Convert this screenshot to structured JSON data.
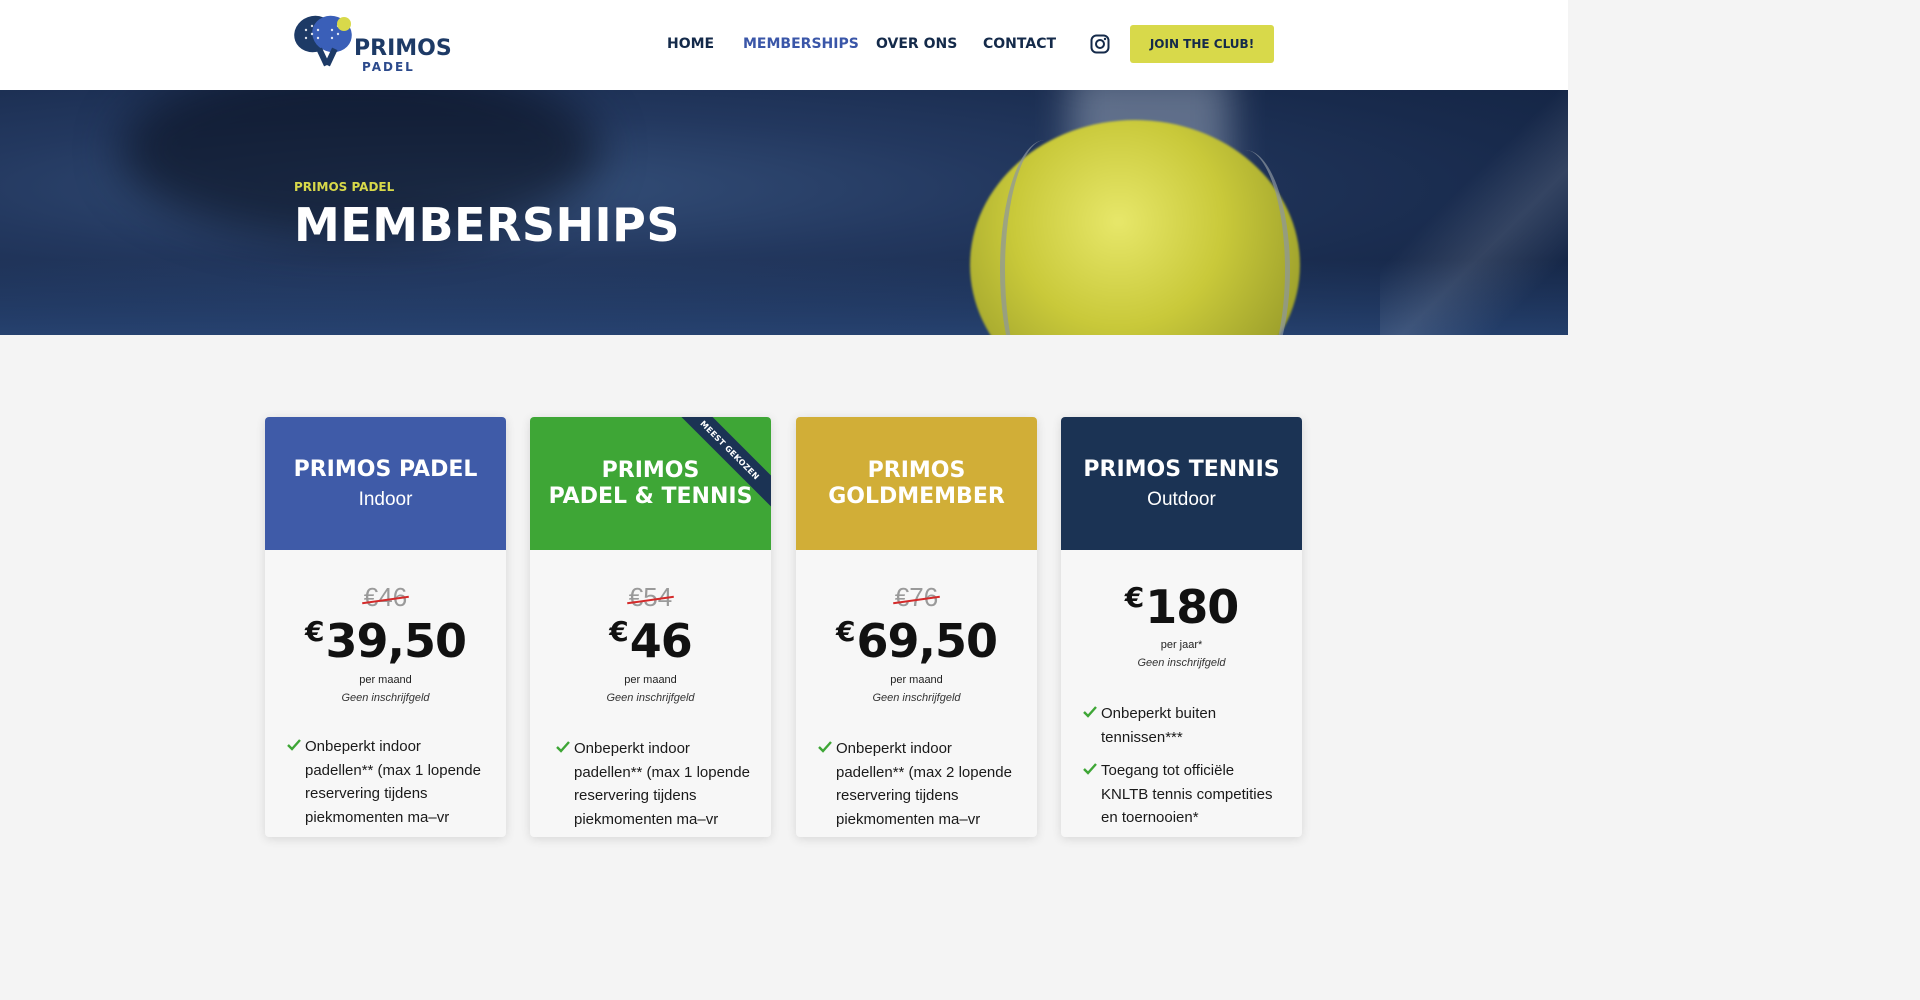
{
  "header": {
    "logo": {
      "word": "PRIMOS",
      "sub": "PADEL"
    },
    "nav": [
      {
        "label": "HOME",
        "active": false
      },
      {
        "label": "MEMBERSHIPS",
        "active": true
      },
      {
        "label": "OVER ONS",
        "active": false
      },
      {
        "label": "CONTACT",
        "active": false
      }
    ],
    "social_icon": "instagram-icon",
    "cta_label": "JOIN THE CLUB!"
  },
  "hero": {
    "subtitle": "PRIMOS PADEL",
    "title": "MEMBERSHIPS"
  },
  "colors": {
    "padel": "#3f5ba8",
    "padel_tennis": "#3ea636",
    "gold": "#d1ae37",
    "tennis": "#1b3354",
    "accent": "#d8d94a",
    "check": "#3ea636"
  },
  "plans": [
    {
      "name": "PRIMOS PADEL",
      "type": "Indoor",
      "old_price": "€46",
      "currency": "€",
      "price": "39,50",
      "period": "per maand",
      "fee": "Geen inschrijfgeld",
      "features": [
        "Onbeperkt indoor padellen** (max 1 lopende reservering tijdens piekmomenten ma–vr"
      ]
    },
    {
      "name": "PRIMOS\nPADEL & TENNIS",
      "type": "",
      "ribbon": "MEEST GEKOZEN",
      "old_price": "€54",
      "currency": "€",
      "price": "46",
      "period": "per maand",
      "fee": "Geen inschrijfgeld",
      "features": [
        "Onbeperkt indoor padellen** (max 1 lopende reservering tijdens piekmomenten ma–vr"
      ]
    },
    {
      "name": "PRIMOS\nGOLDMEMBER",
      "type": "",
      "old_price": "€76",
      "currency": "€",
      "price": "69,50",
      "period": "per maand",
      "fee": "Geen inschrijfgeld",
      "features": [
        "Onbeperkt indoor padellen** (max 2 lopende reservering tijdens piekmomenten ma–vr"
      ]
    },
    {
      "name": "PRIMOS TENNIS",
      "type": "Outdoor",
      "old_price": "",
      "currency": "€",
      "price": "180",
      "period": "per jaar*",
      "fee": "Geen inschrijfgeld",
      "features": [
        "Onbeperkt buiten tennissen***",
        "Toegang tot officiële KNLTB tennis competities en toernooien*"
      ]
    }
  ]
}
